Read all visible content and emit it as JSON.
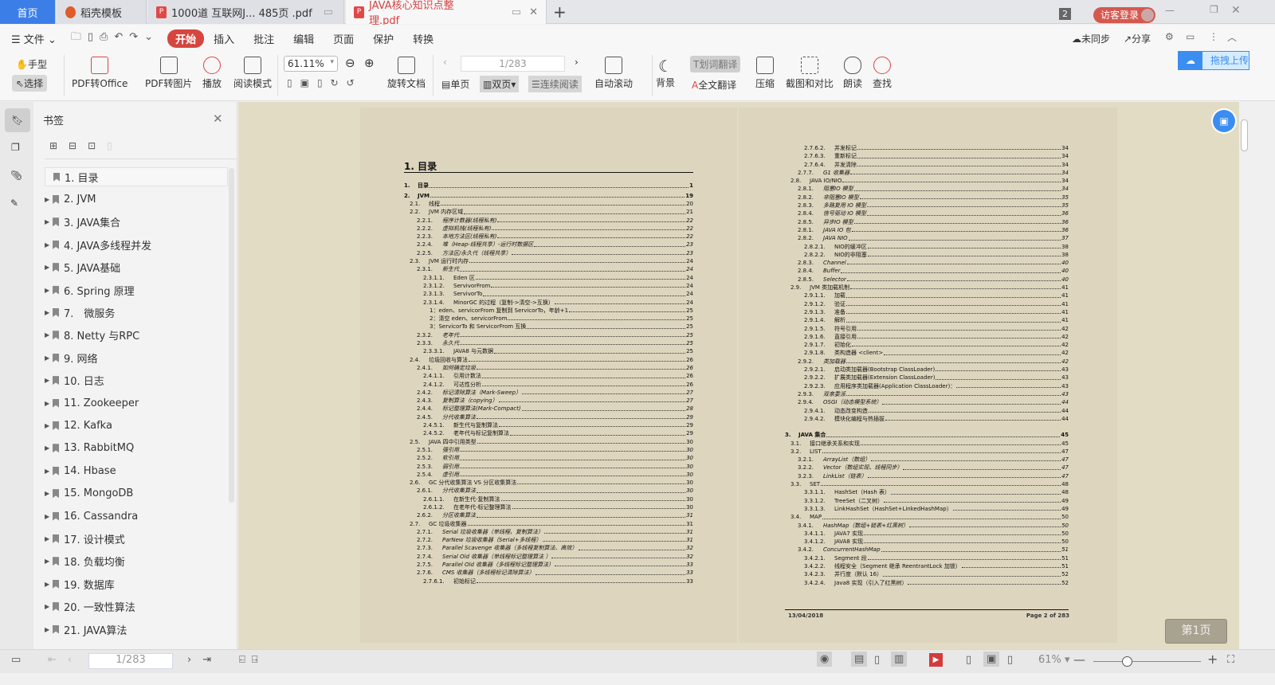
{
  "tabs": [
    {
      "label": "首页"
    },
    {
      "label": "稻壳模板"
    },
    {
      "label": "1000道 互联网J... 485页 .pdf"
    },
    {
      "label": "JAVA核心知识点整理.pdf"
    }
  ],
  "titlebar": {
    "badge": "2",
    "login": "访客登录"
  },
  "menu": {
    "file": "文件",
    "items": [
      "开始",
      "插入",
      "批注",
      "编辑",
      "页面",
      "保护",
      "转换"
    ],
    "right": [
      "未同步",
      "分享"
    ]
  },
  "toolbar": {
    "hand": "手型",
    "select": "选择",
    "pdf_office": "PDF转Office",
    "pdf_img": "PDF转图片",
    "play": "播放",
    "read_mode": "阅读模式",
    "zoom": "61.11%",
    "rotate": "旋转文档",
    "page_input": "1/283",
    "single": "单页",
    "double": "双页",
    "continuous": "连续阅读",
    "autoscroll": "自动滚动",
    "background": "背景",
    "word_translate": "划词翻译",
    "full_translate": "全文翻译",
    "compress": "压缩",
    "screenshot": "截图和对比",
    "read_aloud": "朗读",
    "find": "查找",
    "upload": "拖拽上传"
  },
  "bookmarks": {
    "title": "书签",
    "items": [
      "1. 目录",
      "2. JVM",
      "3. JAVA集合",
      "4. JAVA多线程并发",
      "5. JAVA基础",
      "6. Spring 原理",
      "7.　微服务",
      "8. Netty 与RPC",
      "9. 网络",
      "10. 日志",
      "11. Zookeeper",
      "12. Kafka",
      "13. RabbitMQ",
      "14. Hbase",
      "15. MongoDB",
      "16. Cassandra",
      "17. 设计模式",
      "18. 负载均衡",
      "19. 数据库",
      "20. 一致性算法",
      "21. JAVA算法"
    ]
  },
  "left_page": {
    "heading": "1. 目录",
    "entries": [
      [
        "1.",
        "目录",
        "1",
        0,
        "b"
      ],
      [
        "2.",
        "JVM",
        "19",
        0,
        "b"
      ],
      [
        "2.1.",
        "线程",
        "20",
        1,
        ""
      ],
      [
        "2.2.",
        "JVM 内存区域",
        "21",
        1,
        ""
      ],
      [
        "2.2.1.",
        "程序计数器(线程私有)",
        "22",
        2,
        "i"
      ],
      [
        "2.2.2.",
        "虚拟机栈(线程私有)",
        "22",
        2,
        "i"
      ],
      [
        "2.2.3.",
        "本地方法区(线程私有)",
        "22",
        2,
        "i"
      ],
      [
        "2.2.4.",
        "堆（Heap-线程共享）-运行时数据区",
        "23",
        2,
        "i"
      ],
      [
        "2.2.5.",
        "方法区/永久代（线程共享）",
        "23",
        2,
        "i"
      ],
      [
        "2.3.",
        "JVM 运行时内存",
        "24",
        1,
        ""
      ],
      [
        "2.3.1.",
        "新生代",
        "24",
        2,
        "i"
      ],
      [
        "2.3.1.1.",
        "Eden 区",
        "24",
        3,
        ""
      ],
      [
        "2.3.1.2.",
        "ServivorFrom",
        "24",
        3,
        ""
      ],
      [
        "2.3.1.3.",
        "ServivorTo",
        "24",
        3,
        ""
      ],
      [
        "2.3.1.4.",
        "MinorGC 的过程（复制->清空->互换）",
        "24",
        3,
        ""
      ],
      [
        "",
        "1：eden、servicorFrom 复制到 ServicorTo，年龄+1",
        "25",
        4,
        ""
      ],
      [
        "",
        "2：清空 eden、servicorFrom",
        "25",
        4,
        ""
      ],
      [
        "",
        "3：ServicorTo 和 ServicorFrom 互换",
        "25",
        4,
        ""
      ],
      [
        "2.3.2.",
        "老年代",
        "25",
        2,
        "i"
      ],
      [
        "2.3.3.",
        "永久代",
        "25",
        2,
        "i"
      ],
      [
        "2.3.3.1.",
        "JAVA8 与元数据",
        "25",
        3,
        ""
      ],
      [
        "2.4.",
        "垃圾回收与算法",
        "26",
        1,
        ""
      ],
      [
        "2.4.1.",
        "如何确定垃圾",
        "26",
        2,
        "i"
      ],
      [
        "2.4.1.1.",
        "引用计数法",
        "26",
        3,
        ""
      ],
      [
        "2.4.1.2.",
        "可达性分析",
        "26",
        3,
        ""
      ],
      [
        "2.4.2.",
        "标记清除算法（Mark-Sweep）",
        "27",
        2,
        "i"
      ],
      [
        "2.4.3.",
        "复制算法（copying）",
        "27",
        2,
        "i"
      ],
      [
        "2.4.4.",
        "标记整理算法(Mark-Compact)",
        "28",
        2,
        "i"
      ],
      [
        "2.4.5.",
        "分代收集算法",
        "29",
        2,
        "i"
      ],
      [
        "2.4.5.1.",
        "新生代与复制算法",
        "29",
        3,
        ""
      ],
      [
        "2.4.5.2.",
        "老年代与标记复制算法",
        "29",
        3,
        ""
      ],
      [
        "2.5.",
        "JAVA 四中引用类型",
        "30",
        1,
        ""
      ],
      [
        "2.5.1.",
        "强引用",
        "30",
        2,
        "i"
      ],
      [
        "2.5.2.",
        "软引用",
        "30",
        2,
        "i"
      ],
      [
        "2.5.3.",
        "弱引用",
        "30",
        2,
        "i"
      ],
      [
        "2.5.4.",
        "虚引用",
        "30",
        2,
        "i"
      ],
      [
        "2.6.",
        "GC 分代收集算法 VS 分区收集算法",
        "30",
        1,
        ""
      ],
      [
        "2.6.1.",
        "分代收集算法",
        "30",
        2,
        "i"
      ],
      [
        "2.6.1.1.",
        "在新生代-复制算法",
        "30",
        3,
        ""
      ],
      [
        "2.6.1.2.",
        "在老年代-标记整理算法",
        "30",
        3,
        ""
      ],
      [
        "2.6.2.",
        "分区收集算法",
        "31",
        2,
        "i"
      ],
      [
        "2.7.",
        "GC 垃圾收集器",
        "31",
        1,
        ""
      ],
      [
        "2.7.1.",
        "Serial 垃圾收集器（单线程、复制算法）",
        "31",
        2,
        "i"
      ],
      [
        "2.7.2.",
        "ParNew 垃圾收集器（Serial+多线程）",
        "31",
        2,
        "i"
      ],
      [
        "2.7.3.",
        "Parallel Scavenge 收集器（多线程复制算法、高效）",
        "32",
        2,
        "i"
      ],
      [
        "2.7.4.",
        "Serial Old 收集器（单线程标记整理算法 ）",
        "32",
        2,
        "i"
      ],
      [
        "2.7.5.",
        "Parallel Old 收集器（多线程标记整理算法）",
        "33",
        2,
        "i"
      ],
      [
        "2.7.6.",
        "CMS 收集器（多线程标记清除算法）",
        "33",
        2,
        "i"
      ],
      [
        "2.7.6.1.",
        "初始标记",
        "33",
        3,
        ""
      ]
    ]
  },
  "right_page": {
    "entries": [
      [
        "2.7.6.2.",
        "并发标记",
        "34",
        3,
        ""
      ],
      [
        "2.7.6.3.",
        "重新标记",
        "34",
        3,
        ""
      ],
      [
        "2.7.6.4.",
        "并发清除",
        "34",
        3,
        ""
      ],
      [
        "2.7.7.",
        "G1 收集器",
        "34",
        2,
        "i"
      ],
      [
        "2.8.",
        "JAVA IO/NIO",
        "34",
        1,
        ""
      ],
      [
        "2.8.1.",
        "阻塞IO 模型",
        "34",
        2,
        "i"
      ],
      [
        "2.8.2.",
        "非阻塞IO 模型",
        "35",
        2,
        "i"
      ],
      [
        "2.8.3.",
        "多路复用 IO 模型",
        "35",
        2,
        "i"
      ],
      [
        "2.8.4.",
        "信号驱动 IO 模型",
        "36",
        2,
        "i"
      ],
      [
        "2.8.5.",
        "异步IO 模型",
        "36",
        2,
        "i"
      ],
      [
        "2.8.1.",
        "JAVA IO 包",
        "36",
        2,
        "i"
      ],
      [
        "2.8.2.",
        "JAVA NIO",
        "37",
        2,
        "i"
      ],
      [
        "2.8.2.1.",
        "NIO的缓冲区",
        "38",
        3,
        ""
      ],
      [
        "2.8.2.2.",
        "NIO的非阻塞",
        "38",
        3,
        ""
      ],
      [
        "2.8.3.",
        "Channel",
        "40",
        2,
        "i"
      ],
      [
        "2.8.4.",
        "Buffer",
        "40",
        2,
        "i"
      ],
      [
        "2.8.5.",
        "Selector",
        "40",
        2,
        "i"
      ],
      [
        "2.9.",
        "JVM 类加载机制",
        "41",
        1,
        ""
      ],
      [
        "2.9.1.1.",
        "加载",
        "41",
        3,
        ""
      ],
      [
        "2.9.1.2.",
        "验证",
        "41",
        3,
        ""
      ],
      [
        "2.9.1.3.",
        "准备",
        "41",
        3,
        ""
      ],
      [
        "2.9.1.4.",
        "解析",
        "41",
        3,
        ""
      ],
      [
        "2.9.1.5.",
        "符号引用",
        "42",
        3,
        ""
      ],
      [
        "2.9.1.6.",
        "直接引用",
        "42",
        3,
        ""
      ],
      [
        "2.9.1.7.",
        "初始化",
        "42",
        3,
        ""
      ],
      [
        "2.9.1.8.",
        "类构造器 <client>",
        "42",
        3,
        ""
      ],
      [
        "2.9.2.",
        "类加载器",
        "42",
        2,
        "i"
      ],
      [
        "2.9.2.1.",
        "启动类加载器(Bootstrap ClassLoader)",
        "43",
        3,
        ""
      ],
      [
        "2.9.2.2.",
        "扩展类加载器(Extension ClassLoader)",
        "43",
        3,
        ""
      ],
      [
        "2.9.2.3.",
        "应用程序类加载器(Application ClassLoader)：",
        "43",
        3,
        ""
      ],
      [
        "2.9.3.",
        "双亲委派",
        "43",
        2,
        "i"
      ],
      [
        "2.9.4.",
        "OSGI（动态模型系统）",
        "44",
        2,
        "i"
      ],
      [
        "2.9.4.1.",
        "动态改变构造",
        "44",
        3,
        ""
      ],
      [
        "2.9.4.2.",
        "模块化编程与热插拔",
        "44",
        3,
        ""
      ],
      [
        "3.",
        "JAVA 集合",
        "45",
        0,
        "b"
      ],
      [
        "3.1.",
        "接口继承关系和实现",
        "45",
        1,
        ""
      ],
      [
        "3.2.",
        "LIST",
        "47",
        1,
        ""
      ],
      [
        "3.2.1.",
        "ArrayList（数组）",
        "47",
        2,
        "i"
      ],
      [
        "3.2.2.",
        "Vector（数组实现、线程同步）",
        "47",
        2,
        "i"
      ],
      [
        "3.2.3.",
        "LinkList（链表）",
        "47",
        2,
        "i"
      ],
      [
        "3.3.",
        "SET",
        "48",
        1,
        ""
      ],
      [
        "3.3.1.1.",
        "HashSet（Hash 表）",
        "48",
        3,
        ""
      ],
      [
        "3.3.1.2.",
        "TreeSet（二叉树）",
        "49",
        3,
        ""
      ],
      [
        "3.3.1.3.",
        "LinkHashSet（HashSet+LinkedHashMap）",
        "49",
        3,
        ""
      ],
      [
        "3.4.",
        "MAP",
        "50",
        1,
        ""
      ],
      [
        "3.4.1.",
        "HashMap（数组+链表+红黑树）",
        "50",
        2,
        "i"
      ],
      [
        "3.4.1.1.",
        "JAVA7 实现",
        "50",
        3,
        ""
      ],
      [
        "3.4.1.2.",
        "JAVA8 实现",
        "50",
        3,
        ""
      ],
      [
        "3.4.2.",
        "ConcurrentHashMap",
        "51",
        2,
        "i"
      ],
      [
        "3.4.2.1.",
        "Segment 段",
        "51",
        3,
        ""
      ],
      [
        "3.4.2.2.",
        "线程安全（Segment 继承 ReentrantLock 加锁）",
        "51",
        3,
        ""
      ],
      [
        "3.4.2.3.",
        "并行度（默认 16）",
        "52",
        3,
        ""
      ],
      [
        "3.4.2.4.",
        "Java8 实现（引入了红黑树）",
        "52",
        3,
        ""
      ]
    ],
    "footer_date": "13/04/2018",
    "footer_page": "Page 2 of 283"
  },
  "page_button": "第1页",
  "status": {
    "page_input": "1/283",
    "zoom": "61%",
    "zoom_level_percent": 61
  },
  "colors": {
    "accent": "#3b7ee8",
    "start": "#d5463f",
    "page_bg": "#ddd5be"
  }
}
